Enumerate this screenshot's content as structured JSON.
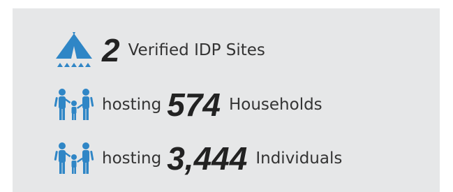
{
  "brand": {
    "accent": "#2f86c6",
    "panel_bg": "#e6e7e8"
  },
  "stats": [
    {
      "icon": "tent-icon",
      "prefix": "",
      "value": "2",
      "label": "Verified IDP Sites"
    },
    {
      "icon": "family-icon",
      "prefix": "hosting",
      "value": "574",
      "label": "Households"
    },
    {
      "icon": "family-icon",
      "prefix": "hosting",
      "value": "3,444",
      "label": "Individuals"
    }
  ]
}
